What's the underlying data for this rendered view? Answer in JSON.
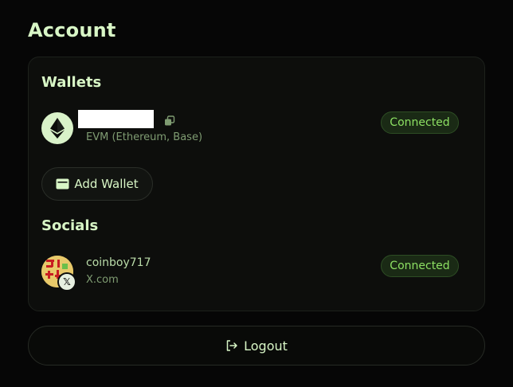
{
  "page": {
    "title": "Account"
  },
  "wallets": {
    "heading": "Wallets",
    "items": [
      {
        "chain_icon": "ethereum-icon",
        "network": "EVM (Ethereum, Base)",
        "status": "Connected"
      }
    ],
    "add_label": "Add Wallet"
  },
  "socials": {
    "heading": "Socials",
    "items": [
      {
        "username": "coinboy717",
        "platform": "X.com",
        "platform_icon": "x-logo-icon",
        "status": "Connected"
      }
    ]
  },
  "footer": {
    "logout_label": "Logout"
  },
  "colors": {
    "background": "#060606",
    "accent_text": "#d8f6c6",
    "connected_green": "#8de063"
  }
}
